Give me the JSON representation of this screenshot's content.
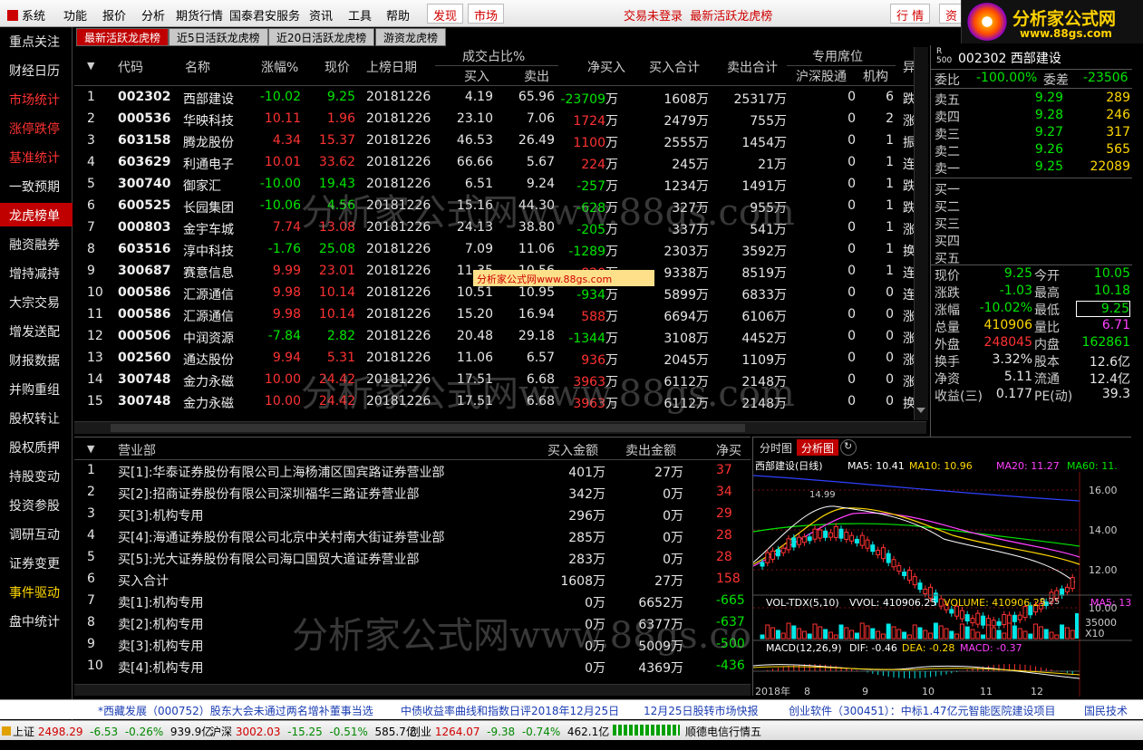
{
  "menu": {
    "items": [
      "系统",
      "功能",
      "报价",
      "分析",
      "期货行情",
      "国泰君安服务",
      "资讯",
      "工具",
      "帮助"
    ],
    "btn_discover": "发现",
    "btn_market": "市场",
    "notice_login": "交易未登录",
    "notice_title": "最新活跃龙虎榜",
    "btn_quote": "行 情",
    "btn_trade": "资"
  },
  "logo": {
    "title": "分析家公式网",
    "url": "www.88gs.com"
  },
  "sidebar": {
    "items": [
      {
        "label": "重点关注",
        "color": "#e6e6e6"
      },
      {
        "label": "财经日历",
        "color": "#e6e6e6"
      },
      {
        "label": "市场统计",
        "color": "#ff3232"
      },
      {
        "label": "涨停跌停",
        "color": "#ff3232"
      },
      {
        "label": "基准统计",
        "color": "#ff3232"
      },
      {
        "label": "一致预期",
        "color": "#e6e6e6"
      },
      {
        "label": "龙虎榜单",
        "color": "#ffffff",
        "active": true
      },
      {
        "label": "融资融券",
        "color": "#e6e6e6"
      },
      {
        "label": "增持减持",
        "color": "#e6e6e6"
      },
      {
        "label": "大宗交易",
        "color": "#e6e6e6"
      },
      {
        "label": "增发送配",
        "color": "#e6e6e6"
      },
      {
        "label": "财报数据",
        "color": "#e6e6e6"
      },
      {
        "label": "并购重组",
        "color": "#e6e6e6"
      },
      {
        "label": "股权转让",
        "color": "#e6e6e6"
      },
      {
        "label": "股权质押",
        "color": "#e6e6e6"
      },
      {
        "label": "持股变动",
        "color": "#e6e6e6"
      },
      {
        "label": "投资参股",
        "color": "#e6e6e6"
      },
      {
        "label": "调研互动",
        "color": "#e6e6e6"
      },
      {
        "label": "证券变更",
        "color": "#e6e6e6"
      },
      {
        "label": "事件驱动",
        "color": "#ffd800"
      },
      {
        "label": "盘中统计",
        "color": "#e6e6e6"
      }
    ]
  },
  "tabs": [
    "最新活跃龙虎榜",
    "近5日活跃龙虎榜",
    "近20日活跃龙虎榜",
    "游资龙虎榜"
  ],
  "top": {
    "headers": {
      "sort": "▼",
      "code": "代码",
      "name": "名称",
      "pct": "涨幅%",
      "price": "现价",
      "date": "上榜日期",
      "ratio": "成交占比%",
      "buy": "买入",
      "sell": "卖出",
      "net": "净买入",
      "buytotal": "买入合计",
      "selltotal": "卖出合计",
      "seats": "专用席位",
      "hs": "沪深股通",
      "inst": "机构",
      "abn": "异"
    },
    "unit": "万",
    "rows": [
      {
        "n": "1",
        "code": "002302",
        "name": "西部建设",
        "pct": "-10.02",
        "price": "9.25",
        "date": "20181226",
        "buy": "4.19",
        "sell": "65.96",
        "net": "-23709",
        "bt": "1608",
        "st": "25317",
        "hs": "0",
        "inst": "6",
        "abn": "跌",
        "dir": "dn"
      },
      {
        "n": "2",
        "code": "000536",
        "name": "华映科技",
        "pct": "10.11",
        "price": "1.96",
        "date": "20181226",
        "buy": "23.10",
        "sell": "7.06",
        "net": "1724",
        "bt": "2479",
        "st": "755",
        "hs": "0",
        "inst": "2",
        "abn": "涨",
        "dir": "up"
      },
      {
        "n": "3",
        "code": "603158",
        "name": "腾龙股份",
        "pct": "4.34",
        "price": "15.37",
        "date": "20181226",
        "buy": "46.53",
        "sell": "26.49",
        "net": "1100",
        "bt": "2555",
        "st": "1454",
        "hs": "0",
        "inst": "1",
        "abn": "振",
        "dir": "up"
      },
      {
        "n": "4",
        "code": "603629",
        "name": "利通电子",
        "pct": "10.01",
        "price": "33.62",
        "date": "20181226",
        "buy": "66.66",
        "sell": "5.67",
        "net": "224",
        "bt": "245",
        "st": "21",
        "hs": "0",
        "inst": "1",
        "abn": "连",
        "dir": "up"
      },
      {
        "n": "5",
        "code": "300740",
        "name": "御家汇",
        "pct": "-10.00",
        "price": "19.43",
        "date": "20181226",
        "buy": "6.51",
        "sell": "9.24",
        "net": "-257",
        "bt": "1234",
        "st": "1491",
        "hs": "0",
        "inst": "1",
        "abn": "跌",
        "dir": "dn"
      },
      {
        "n": "6",
        "code": "600525",
        "name": "长园集团",
        "pct": "-10.06",
        "price": "4.56",
        "date": "20181226",
        "buy": "15.16",
        "sell": "44.30",
        "net": "-628",
        "bt": "327",
        "st": "955",
        "hs": "0",
        "inst": "1",
        "abn": "跌",
        "dir": "dn"
      },
      {
        "n": "7",
        "code": "000803",
        "name": "金宇车城",
        "pct": "7.74",
        "price": "13.08",
        "date": "20181226",
        "buy": "24.13",
        "sell": "38.80",
        "net": "-205",
        "bt": "337",
        "st": "541",
        "hs": "0",
        "inst": "1",
        "abn": "涨",
        "dir": "up",
        "netdir": "dn"
      },
      {
        "n": "8",
        "code": "603516",
        "name": "淳中科技",
        "pct": "-1.76",
        "price": "25.08",
        "date": "20181226",
        "buy": "7.09",
        "sell": "11.06",
        "net": "-1289",
        "bt": "2303",
        "st": "3592",
        "hs": "0",
        "inst": "1",
        "abn": "换",
        "dir": "dn"
      },
      {
        "n": "9",
        "code": "300687",
        "name": "赛意信息",
        "pct": "9.99",
        "price": "23.01",
        "date": "20181226",
        "buy": "11.35",
        "sell": "10.56",
        "net": "820",
        "bt": "9338",
        "st": "8519",
        "hs": "0",
        "inst": "1",
        "abn": "连",
        "dir": "up"
      },
      {
        "n": "10",
        "code": "000586",
        "name": "汇源通信",
        "pct": "9.98",
        "price": "10.14",
        "date": "20181226",
        "buy": "10.51",
        "sell": "10.95",
        "net": "-934",
        "bt": "5899",
        "st": "6833",
        "hs": "0",
        "inst": "0",
        "abn": "连",
        "dir": "up",
        "netdir": "dn"
      },
      {
        "n": "11",
        "code": "000586",
        "name": "汇源通信",
        "pct": "9.98",
        "price": "10.14",
        "date": "20181226",
        "buy": "15.20",
        "sell": "16.94",
        "net": "588",
        "bt": "6694",
        "st": "6106",
        "hs": "0",
        "inst": "0",
        "abn": "涨",
        "dir": "up"
      },
      {
        "n": "12",
        "code": "000506",
        "name": "中润资源",
        "pct": "-7.84",
        "price": "2.82",
        "date": "20181226",
        "buy": "20.48",
        "sell": "29.18",
        "net": "-1344",
        "bt": "3108",
        "st": "4452",
        "hs": "0",
        "inst": "0",
        "abn": "涨",
        "dir": "dn"
      },
      {
        "n": "13",
        "code": "002560",
        "name": "通达股份",
        "pct": "9.94",
        "price": "5.31",
        "date": "20181226",
        "buy": "11.06",
        "sell": "6.57",
        "net": "936",
        "bt": "2045",
        "st": "1109",
        "hs": "0",
        "inst": "0",
        "abn": "涨",
        "dir": "up"
      },
      {
        "n": "14",
        "code": "300748",
        "name": "金力永磁",
        "pct": "10.00",
        "price": "24.42",
        "date": "20181226",
        "buy": "17.51",
        "sell": "6.68",
        "net": "3963",
        "bt": "6112",
        "st": "2148",
        "hs": "0",
        "inst": "0",
        "abn": "涨",
        "dir": "up"
      },
      {
        "n": "15",
        "code": "300748",
        "name": "金力永磁",
        "pct": "10.00",
        "price": "24.42",
        "date": "20181226",
        "buy": "17.51",
        "sell": "6.68",
        "net": "3963",
        "bt": "6112",
        "st": "2148",
        "hs": "0",
        "inst": "0",
        "abn": "换",
        "dir": "up"
      }
    ]
  },
  "quote": {
    "code": "002302",
    "name": "西部建设",
    "rbadge": "R",
    "rnum": "500",
    "wb_label": "委比",
    "wb": "-100.00%",
    "wc_label": "委差",
    "wc": "-23506",
    "asks": [
      {
        "l": "卖五",
        "p": "9.29",
        "v": "289"
      },
      {
        "l": "卖四",
        "p": "9.28",
        "v": "246"
      },
      {
        "l": "卖三",
        "p": "9.27",
        "v": "317"
      },
      {
        "l": "卖二",
        "p": "9.26",
        "v": "565"
      },
      {
        "l": "卖一",
        "p": "9.25",
        "v": "22089"
      }
    ],
    "bids": [
      "买一",
      "买二",
      "买三",
      "买四",
      "买五"
    ],
    "stats": [
      {
        "l1": "现价",
        "v1": "9.25",
        "c1": "#00e600",
        "l2": "今开",
        "v2": "10.05",
        "c2": "#00e600"
      },
      {
        "l1": "涨跌",
        "v1": "-1.03",
        "c1": "#00e600",
        "l2": "最高",
        "v2": "10.18",
        "c2": "#00e600"
      },
      {
        "l1": "涨幅",
        "v1": "-10.02%",
        "c1": "#00e600",
        "l2": "最低",
        "v2": "9.25",
        "c2": "#00e600"
      },
      {
        "l1": "总量",
        "v1": "410906",
        "c1": "#ffd800",
        "l2": "量比",
        "v2": "6.71",
        "c2": "#ff40ff"
      },
      {
        "l1": "外盘",
        "v1": "248045",
        "c1": "#ff3232",
        "l2": "内盘",
        "v2": "162861",
        "c2": "#00e600"
      },
      {
        "l1": "换手",
        "v1": "3.32%",
        "c1": "#e6e6e6",
        "l2": "股本",
        "v2": "12.6亿",
        "c2": "#e6e6e6"
      },
      {
        "l1": "净资",
        "v1": "5.11",
        "c1": "#e6e6e6",
        "l2": "流通",
        "v2": "12.4亿",
        "c2": "#e6e6e6"
      },
      {
        "l1": "收益(三)",
        "v1": "0.177",
        "c1": "#e6e6e6",
        "l2": "PE(动)",
        "v2": "39.3",
        "c2": "#e6e6e6"
      }
    ]
  },
  "bottom": {
    "headers": {
      "sort": "▼",
      "dept": "营业部",
      "buy": "买入金额",
      "sell": "卖出金额",
      "net": "净买"
    },
    "rows": [
      {
        "n": "1",
        "dept": "买[1]:华泰证券股份有限公司上海杨浦区国宾路证券营业部",
        "buy": "401",
        "sell": "27",
        "net": "37"
      },
      {
        "n": "2",
        "dept": "买[2]:招商证券股份有限公司深圳福华三路证券营业部",
        "buy": "342",
        "sell": "0",
        "net": "34"
      },
      {
        "n": "3",
        "dept": "买[3]:机构专用",
        "buy": "296",
        "sell": "0",
        "net": "29"
      },
      {
        "n": "4",
        "dept": "买[4]:海通证券股份有限公司北京中关村南大街证券营业部",
        "buy": "285",
        "sell": "0",
        "net": "28"
      },
      {
        "n": "5",
        "dept": "买[5]:光大证券股份有限公司海口国贸大道证券营业部",
        "buy": "283",
        "sell": "0",
        "net": "28"
      },
      {
        "n": "6",
        "dept": "买入合计",
        "buy": "1608",
        "sell": "27",
        "net": "158"
      },
      {
        "n": "7",
        "dept": "卖[1]:机构专用",
        "buy": "0",
        "sell": "6652",
        "net": "-665"
      },
      {
        "n": "8",
        "dept": "卖[2]:机构专用",
        "buy": "0",
        "sell": "6377",
        "net": "-637"
      },
      {
        "n": "9",
        "dept": "卖[3]:机构专用",
        "buy": "0",
        "sell": "5009",
        "net": "-500"
      },
      {
        "n": "10",
        "dept": "卖[4]:机构专用",
        "buy": "0",
        "sell": "4369",
        "net": "-436"
      }
    ]
  },
  "chart": {
    "tabs": [
      "分时图",
      "分析图"
    ],
    "kline_title": "西部建设(日线)",
    "ma5": "MA5: 10.41",
    "ma10": "MA10: 10.96",
    "ma20": "MA20: 11.27",
    "ma60": "MA60: 11.",
    "y_ticks": [
      "16.00",
      "14.00",
      "12.00",
      "10.00"
    ],
    "high_label": "14.99",
    "low_label": "9.25",
    "vol_title": "VOL-TDX(5,10)",
    "vvol": "VVOL: 410906.25",
    "volume": "VOLUME: 410906.25",
    "vma5": "MA5: 13",
    "vol_tick": "35000",
    "vol_mult": "X10",
    "macd_title": "MACD(12,26,9)",
    "dif": "DIF: -0.46",
    "dea": "DEA: -0.28",
    "macd": "MACD: -0.37",
    "x_labels": [
      "2018年",
      "8",
      "9",
      "10",
      "11",
      "12"
    ],
    "colors": {
      "ma5": "#ffffff",
      "ma10": "#ffd800",
      "ma20": "#ff40ff",
      "ma60": "#00e600",
      "ma_long": "#3040ff"
    }
  },
  "ticker": [
    "*西藏发展（000752）股东大会未通过两名增补董事当选",
    "中债收益率曲线和指数日评2018年12月25日",
    "12月25日股转市场快报",
    "创业软件（300451）：中标1.47亿元智能医院建设项目",
    "国民技术"
  ],
  "indexbar": {
    "sh_label": "上证",
    "sh": "2498.29",
    "sh_chg": "-6.53",
    "sh_pct": "-0.26%",
    "sh_amt": "939.9亿",
    "sz_label": "沪深",
    "sz": "3002.03",
    "sz_chg": "-15.25",
    "sz_pct": "-0.51%",
    "sz_amt": "585.7亿",
    "cy_label": "创业",
    "cy": "1264.07",
    "cy_chg": "-9.38",
    "cy_pct": "-0.74%",
    "cy_amt": "462.1亿",
    "news": "顺德电信行情五"
  },
  "watermark": {
    "text": "分析家公式网www.88gs.com",
    "stamp": "分析家公式网www.88gs.com"
  }
}
